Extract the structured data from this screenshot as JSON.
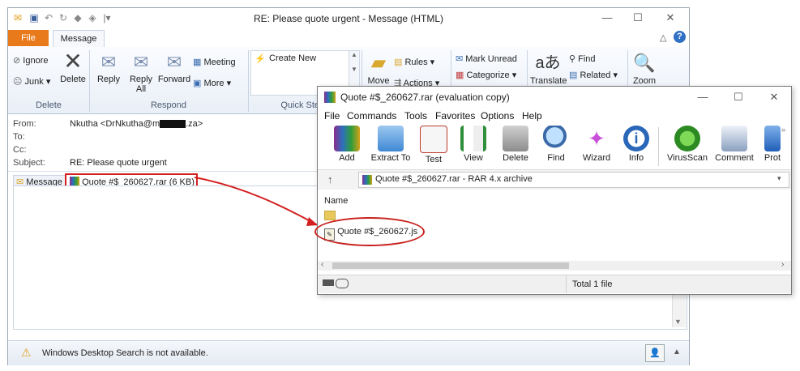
{
  "outlook": {
    "title": "RE: Please quote urgent  -  Message (HTML)",
    "tabs": {
      "file": "File",
      "message": "Message"
    },
    "ribbon": {
      "ignore": "Ignore",
      "junk": "Junk",
      "delete": "Delete",
      "reply": "Reply",
      "reply_all": "Reply All",
      "forward": "Forward",
      "meeting": "Meeting",
      "more": "More",
      "create_new": "Create New",
      "move": "Move",
      "rules": "Rules",
      "actions": "Actions",
      "mark_unread": "Mark Unread",
      "categorize": "Categorize",
      "translate": "Translate",
      "find": "Find",
      "related": "Related",
      "zoom": "Zoom",
      "group_delete": "Delete",
      "group_respond": "Respond",
      "group_quick_steps": "Quick Steps"
    },
    "header": {
      "from_label": "From:",
      "from_value": "Nkutha <DrNkutha@m",
      "from_value_tail": ".za>",
      "to_label": "To:",
      "cc_label": "Cc:",
      "subject_label": "Subject:",
      "subject_value": "RE: Please quote urgent",
      "message_tab": "Message",
      "attachment": "Quote #$_260627.rar  (6 KB)"
    },
    "status_text": "Windows Desktop Search is not available."
  },
  "winrar": {
    "title": "Quote #$_260627.rar (evaluation copy)",
    "menu": [
      "File",
      "Commands",
      "Tools",
      "Favorites",
      "Options",
      "Help"
    ],
    "toolbar": [
      "Add",
      "Extract To",
      "Test",
      "View",
      "Delete",
      "Find",
      "Wizard",
      "Info",
      "VirusScan",
      "Comment",
      "Prot"
    ],
    "address": "Quote #$_260627.rar - RAR 4.x archive",
    "column_name": "Name",
    "file": "Quote #$_260627.js",
    "status_total": "Total 1 file"
  },
  "colors": {
    "file_tab": "#e87a1b",
    "highlight_red": "#d42020",
    "ribbon_bg": "#e9eff7"
  }
}
